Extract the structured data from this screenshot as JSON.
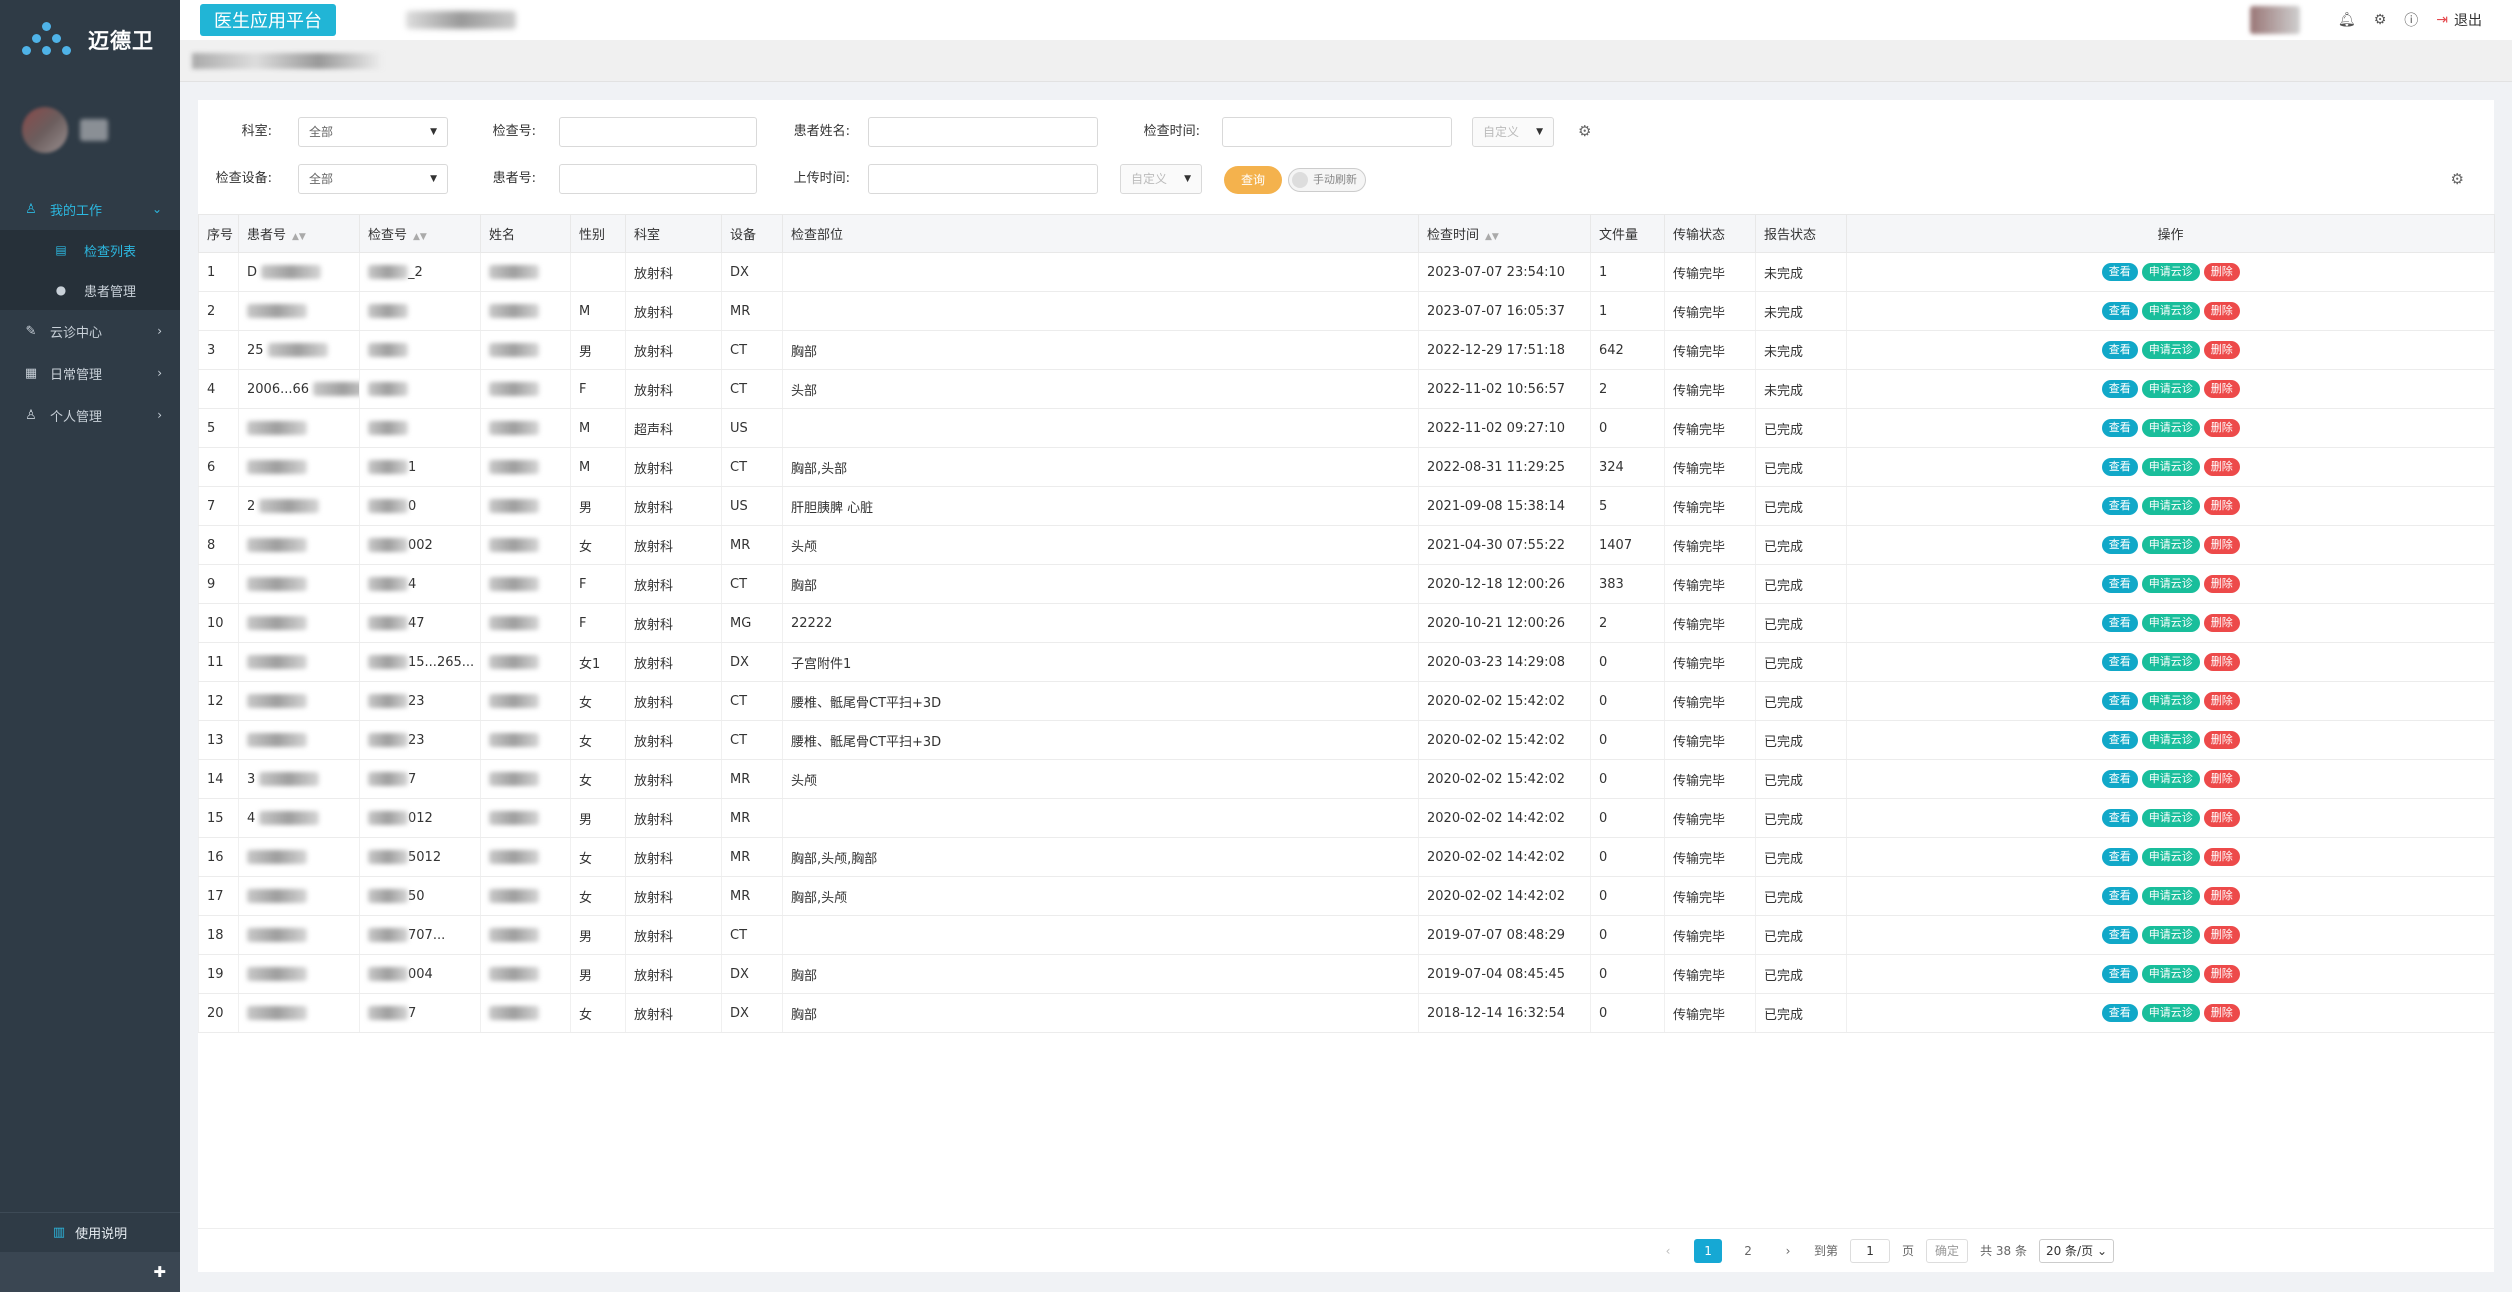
{
  "brand": {
    "name": "迈德卫",
    "platform": "医生应用平台"
  },
  "header": {
    "logout": "退出"
  },
  "sidebar": {
    "menu": [
      {
        "label": "我的工作",
        "icon": "user-icon",
        "active": true
      },
      {
        "label": "云诊中心",
        "icon": "edit-icon",
        "active": false
      },
      {
        "label": "日常管理",
        "icon": "calendar-icon",
        "active": false
      },
      {
        "label": "个人管理",
        "icon": "person-icon",
        "active": false
      }
    ],
    "submenu": [
      {
        "label": "检查列表",
        "active": true
      },
      {
        "label": "患者管理",
        "active": false
      }
    ],
    "help": "使用说明"
  },
  "filters": {
    "department_label": "科室:",
    "department_value": "全部",
    "exam_no_label": "检查号:",
    "patient_name_label": "患者姓名:",
    "exam_time_label": "检查时间:",
    "exam_time_mode": "自定义",
    "device_label": "检查设备:",
    "device_value": "全部",
    "patient_no_label": "患者号:",
    "upload_time_label": "上传时间:",
    "upload_time_mode": "自定义",
    "query_button": "查询",
    "manual_refresh": "手动刷新"
  },
  "table": {
    "headers": [
      "序号",
      "患者号",
      "检查号",
      "姓名",
      "性别",
      "科室",
      "设备",
      "检查部位",
      "检查时间",
      "文件量",
      "传输状态",
      "报告状态",
      "操作"
    ],
    "ops": {
      "view": "查看",
      "apply": "申请云诊",
      "delete": "删除"
    },
    "rows": [
      {
        "no": "1",
        "pid": "D",
        "eid": "_2",
        "gender": "",
        "dept": "放射科",
        "dev": "DX",
        "part": "",
        "time": "2023-07-07 23:54:10",
        "files": "1",
        "transfer": "传输完毕",
        "report": "未完成"
      },
      {
        "no": "2",
        "pid": "",
        "eid": "",
        "gender": "M",
        "dept": "放射科",
        "dev": "MR",
        "part": "",
        "time": "2023-07-07 16:05:37",
        "files": "1",
        "transfer": "传输完毕",
        "report": "未完成"
      },
      {
        "no": "3",
        "pid": "25",
        "eid": "",
        "gender": "男",
        "dept": "放射科",
        "dev": "CT",
        "part": "胸部",
        "time": "2022-12-29 17:51:18",
        "files": "642",
        "transfer": "传输完毕",
        "report": "未完成"
      },
      {
        "no": "4",
        "pid": "2006...66",
        "eid": "",
        "gender": "F",
        "dept": "放射科",
        "dev": "CT",
        "part": "头部",
        "time": "2022-11-02 10:56:57",
        "files": "2",
        "transfer": "传输完毕",
        "report": "未完成"
      },
      {
        "no": "5",
        "pid": "",
        "eid": "",
        "gender": "M",
        "dept": "超声科",
        "dev": "US",
        "part": "",
        "time": "2022-11-02 09:27:10",
        "files": "0",
        "transfer": "传输完毕",
        "report": "已完成"
      },
      {
        "no": "6",
        "pid": "",
        "eid": "1",
        "gender": "M",
        "dept": "放射科",
        "dev": "CT",
        "part": "胸部,头部",
        "time": "2022-08-31 11:29:25",
        "files": "324",
        "transfer": "传输完毕",
        "report": "已完成"
      },
      {
        "no": "7",
        "pid": "2",
        "eid": "0",
        "gender": "男",
        "dept": "放射科",
        "dev": "US",
        "part": "肝胆胰脾 心脏",
        "time": "2021-09-08 15:38:14",
        "files": "5",
        "transfer": "传输完毕",
        "report": "已完成"
      },
      {
        "no": "8",
        "pid": "",
        "eid": "002",
        "gender": "女",
        "dept": "放射科",
        "dev": "MR",
        "part": "头颅",
        "time": "2021-04-30 07:55:22",
        "files": "1407",
        "transfer": "传输完毕",
        "report": "已完成"
      },
      {
        "no": "9",
        "pid": "",
        "eid": "4",
        "gender": "F",
        "dept": "放射科",
        "dev": "CT",
        "part": "胸部",
        "time": "2020-12-18 12:00:26",
        "files": "383",
        "transfer": "传输完毕",
        "report": "已完成"
      },
      {
        "no": "10",
        "pid": "",
        "eid": "47",
        "gender": "F",
        "dept": "放射科",
        "dev": "MG",
        "part": "22222",
        "time": "2020-10-21 12:00:26",
        "files": "2",
        "transfer": "传输完毕",
        "report": "已完成"
      },
      {
        "no": "11",
        "pid": "",
        "eid": "15...265...",
        "gender": "女1",
        "dept": "放射科",
        "dev": "DX",
        "part": "子宫附件1",
        "time": "2020-03-23 14:29:08",
        "files": "0",
        "transfer": "传输完毕",
        "report": "已完成"
      },
      {
        "no": "12",
        "pid": "",
        "eid": "23",
        "gender": "女",
        "dept": "放射科",
        "dev": "CT",
        "part": "腰椎、骶尾骨CT平扫+3D",
        "time": "2020-02-02 15:42:02",
        "files": "0",
        "transfer": "传输完毕",
        "report": "已完成"
      },
      {
        "no": "13",
        "pid": "",
        "eid": "23",
        "gender": "女",
        "dept": "放射科",
        "dev": "CT",
        "part": "腰椎、骶尾骨CT平扫+3D",
        "time": "2020-02-02 15:42:02",
        "files": "0",
        "transfer": "传输完毕",
        "report": "已完成"
      },
      {
        "no": "14",
        "pid": "3",
        "eid": "7",
        "gender": "女",
        "dept": "放射科",
        "dev": "MR",
        "part": "头颅",
        "time": "2020-02-02 15:42:02",
        "files": "0",
        "transfer": "传输完毕",
        "report": "已完成"
      },
      {
        "no": "15",
        "pid": "4",
        "eid": "012",
        "gender": "男",
        "dept": "放射科",
        "dev": "MR",
        "part": "",
        "time": "2020-02-02 14:42:02",
        "files": "0",
        "transfer": "传输完毕",
        "report": "已完成"
      },
      {
        "no": "16",
        "pid": "",
        "eid": "5012",
        "gender": "女",
        "dept": "放射科",
        "dev": "MR",
        "part": "胸部,头颅,胸部",
        "time": "2020-02-02 14:42:02",
        "files": "0",
        "transfer": "传输完毕",
        "report": "已完成"
      },
      {
        "no": "17",
        "pid": "",
        "eid": "50",
        "gender": "女",
        "dept": "放射科",
        "dev": "MR",
        "part": "胸部,头颅",
        "time": "2020-02-02 14:42:02",
        "files": "0",
        "transfer": "传输完毕",
        "report": "已完成"
      },
      {
        "no": "18",
        "pid": "",
        "eid": "707...",
        "gender": "男",
        "dept": "放射科",
        "dev": "CT",
        "part": "",
        "time": "2019-07-07 08:48:29",
        "files": "0",
        "transfer": "传输完毕",
        "report": "已完成"
      },
      {
        "no": "19",
        "pid": "",
        "eid": "004",
        "gender": "男",
        "dept": "放射科",
        "dev": "DX",
        "part": "胸部",
        "time": "2019-07-04 08:45:45",
        "files": "0",
        "transfer": "传输完毕",
        "report": "已完成"
      },
      {
        "no": "20",
        "pid": "",
        "eid": "7",
        "gender": "女",
        "dept": "放射科",
        "dev": "DX",
        "part": "胸部",
        "time": "2018-12-14 16:32:54",
        "files": "0",
        "transfer": "传输完毕",
        "report": "已完成"
      }
    ]
  },
  "pagination": {
    "pages": [
      "1",
      "2"
    ],
    "current": "1",
    "goto_label": "到第",
    "goto_value": "1",
    "page_unit": "页",
    "confirm": "确定",
    "total": "共 38 条",
    "page_size": "20 条/页"
  },
  "colors": {
    "accent": "#21b5d6",
    "sidebar": "#2f3b46",
    "transfer": "#19be6b",
    "incomplete": "#ed3f3f",
    "complete": "#2d8cf0",
    "query": "#f4b24d"
  }
}
